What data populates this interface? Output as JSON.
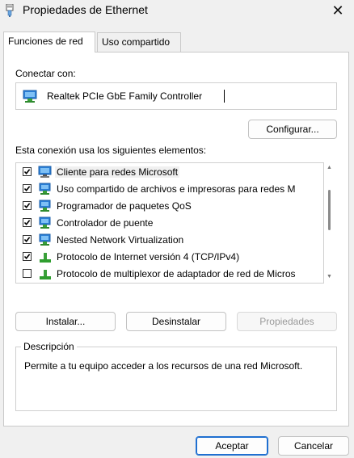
{
  "window": {
    "title": "Propiedades de Ethernet",
    "close_glyph": "✕",
    "icon": "ethernet-connector-icon"
  },
  "tabs": [
    {
      "label": "Funciones de red",
      "active": true
    },
    {
      "label": "Uso compartido",
      "active": false
    }
  ],
  "connect": {
    "label": "Conectar con:",
    "adapter_name": "Realtek PCIe GbE Family Controller",
    "adapter_icon": "network-adapter-icon",
    "configure_label": "Configurar..."
  },
  "components": {
    "label": "Esta conexión usa los siguientes elementos:",
    "items": [
      {
        "label": "Cliente para redes Microsoft",
        "checked": true,
        "icon": "network-client-icon",
        "selected": true
      },
      {
        "label": "Uso compartido de archivos e impresoras para redes M",
        "checked": true,
        "icon": "network-service-icon"
      },
      {
        "label": "Programador de paquetes QoS",
        "checked": true,
        "icon": "network-service-icon"
      },
      {
        "label": "Controlador de puente",
        "checked": true,
        "icon": "network-service-icon"
      },
      {
        "label": "Nested Network Virtualization",
        "checked": true,
        "icon": "network-service-icon"
      },
      {
        "label": "Protocolo de Internet versión 4 (TCP/IPv4)",
        "checked": true,
        "icon": "protocol-icon"
      },
      {
        "label": "Protocolo de multiplexor de adaptador de red de Micros",
        "checked": false,
        "icon": "protocol-icon"
      }
    ]
  },
  "actions": {
    "install": "Instalar...",
    "uninstall": "Desinstalar",
    "properties": "Propiedades"
  },
  "description": {
    "title": "Descripción",
    "text": "Permite a tu equipo acceder a los recursos de una red Microsoft."
  },
  "footer": {
    "ok": "Aceptar",
    "cancel": "Cancelar"
  },
  "colors": {
    "accent": "#1f6fd0",
    "protocol_green": "#2f9e2f",
    "monitor_blue": "#2b7fd6"
  }
}
